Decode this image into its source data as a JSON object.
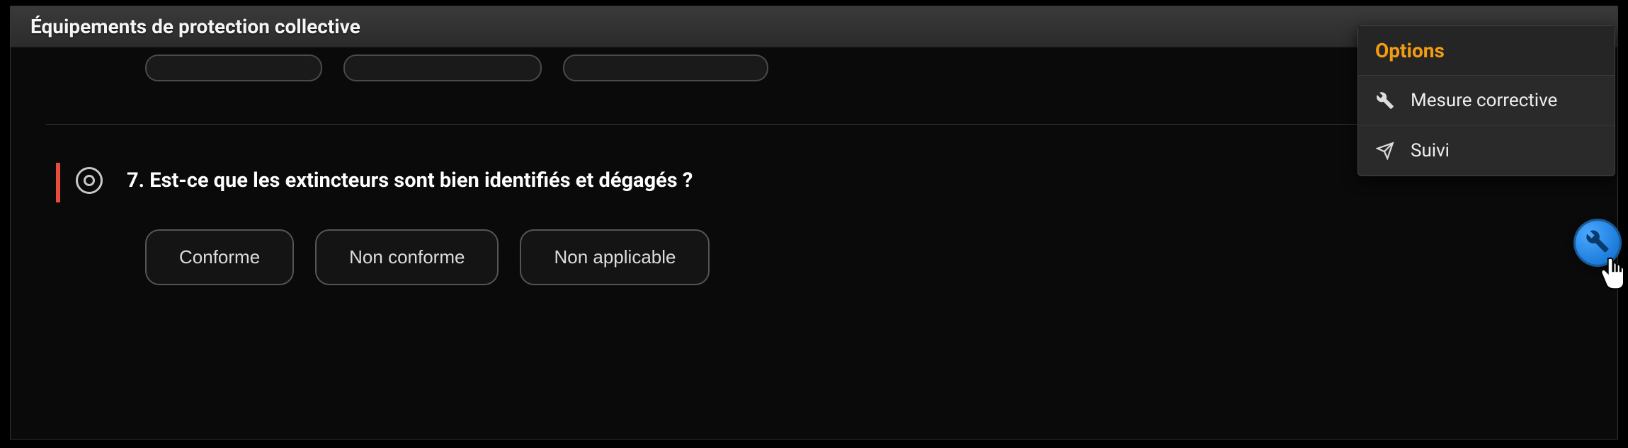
{
  "panel": {
    "title": "Équipements de protection collective"
  },
  "question": {
    "number_and_text": "7. Est-ce que les extincteurs sont bien identifiés et dégagés ?"
  },
  "answers": {
    "conforme": "Conforme",
    "non_conforme": "Non conforme",
    "non_applicable": "Non applicable"
  },
  "options": {
    "header": "Options",
    "items": {
      "mesure_corrective": "Mesure corrective",
      "suivi": "Suivi"
    }
  },
  "icons": {
    "tools": "tools-icon",
    "send": "send-icon",
    "wrench": "wrench-icon"
  }
}
